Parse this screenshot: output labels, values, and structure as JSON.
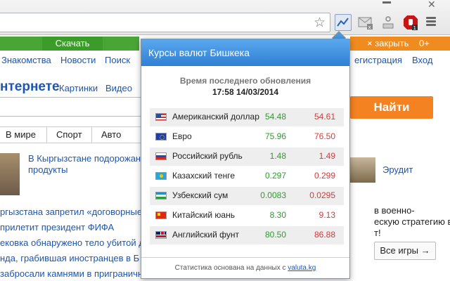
{
  "browser": {
    "icons": [
      "star-icon",
      "chart-extension-icon",
      "mail-extension-icon",
      "user-extension-icon",
      "stop-extension-icon",
      "menu-icon"
    ]
  },
  "page": {
    "download_label": "Скачать",
    "close_label": "× закрыть",
    "counter": "0+",
    "nav": {
      "dating": "Знакомства",
      "news": "Новости",
      "search": "Поиск",
      "registration": "егистрация",
      "login": "Вход"
    },
    "search_title": "нтернете",
    "search_subnav": {
      "images": "Картинки",
      "video": "Видео"
    },
    "search_button": "Найти",
    "tabs": [
      "В мире",
      "Спорт",
      "Авто"
    ],
    "news": [
      "В Кыргызстане подорожан",
      "продукты",
      "ргызстана запретил «договорные»",
      "прилетит президент ФИФА",
      "ековка обнаружено тело убитой дев",
      "нда, грабившая иностранцев в Б",
      "забросали камнями в приграничн"
    ],
    "game": {
      "title": "Эрудит",
      "lines": [
        "в военно-",
        "ескую стратегию в",
        "т!"
      ],
      "all_games": "Все игры →"
    }
  },
  "popup": {
    "title": "Курсы валют Бишкека",
    "updated_label": "Время последнего обновления",
    "updated_time": "17:58 14/03/2014",
    "rates": [
      {
        "flag": "us-flag-icon",
        "name": "Американский доллар",
        "buy": "54.48",
        "sell": "54.61"
      },
      {
        "flag": "eu-flag-icon",
        "name": "Евро",
        "buy": "75.96",
        "sell": "76.50"
      },
      {
        "flag": "ru-flag-icon",
        "name": "Российский рубль",
        "buy": "1.48",
        "sell": "1.49"
      },
      {
        "flag": "kz-flag-icon",
        "name": "Казахский тенге",
        "buy": "0.297",
        "sell": "0.299"
      },
      {
        "flag": "uz-flag-icon",
        "name": "Узбекский сум",
        "buy": "0.0083",
        "sell": "0.0295"
      },
      {
        "flag": "cn-flag-icon",
        "name": "Китайский юань",
        "buy": "8.30",
        "sell": "9.13"
      },
      {
        "flag": "gb-flag-icon",
        "name": "Английский фунт",
        "buy": "80.50",
        "sell": "86.88"
      }
    ],
    "footer_text": "Статистика основана на данных с",
    "footer_link": "valuta.kg",
    "colors": {
      "buy": "#2e9b2e",
      "sell": "#d43b3b",
      "header": "#3d8fe0"
    }
  }
}
